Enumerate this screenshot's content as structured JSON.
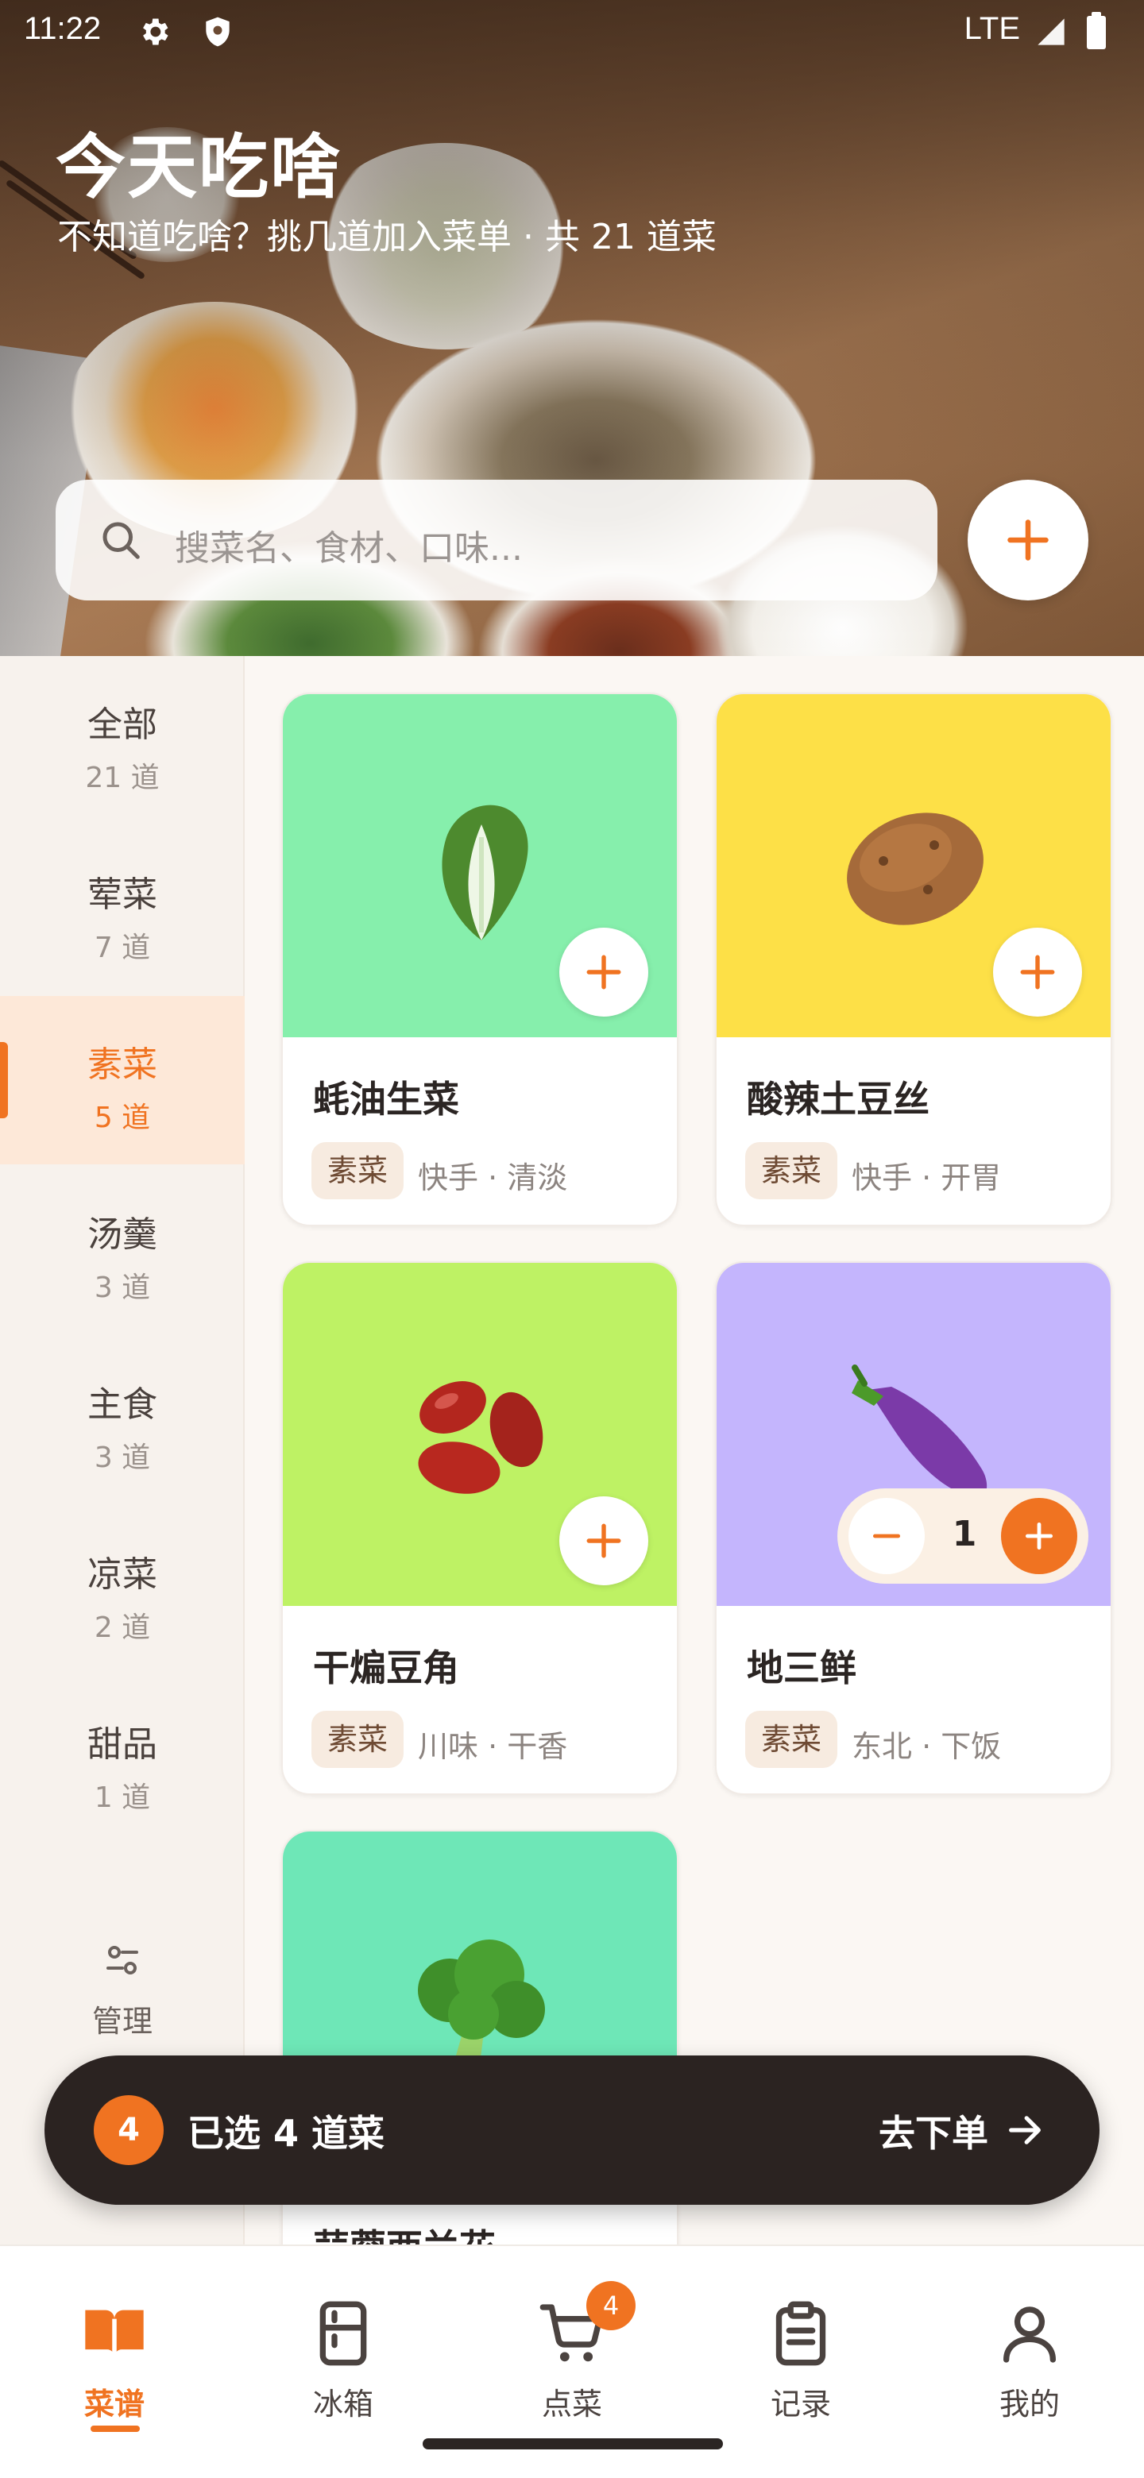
{
  "status": {
    "time": "11:22",
    "network": "LTE",
    "icons": [
      "gear-icon",
      "shield-icon",
      "signal-icon",
      "battery-icon"
    ]
  },
  "header": {
    "title": "今天吃啥",
    "subtitle": "不知道吃啥？挑几道加入菜单 · 共 21 道菜"
  },
  "search": {
    "placeholder": "搜菜名、食材、口味..."
  },
  "sidebar": {
    "categories": [
      {
        "name": "全部",
        "count": "21 道"
      },
      {
        "name": "荤菜",
        "count": "7 道"
      },
      {
        "name": "素菜",
        "count": "5 道",
        "active": true
      },
      {
        "name": "汤羹",
        "count": "3 道"
      },
      {
        "name": "主食",
        "count": "3 道"
      },
      {
        "name": "凉菜",
        "count": "2 道"
      },
      {
        "name": "甜品",
        "count": "1 道"
      }
    ],
    "manage": "管理"
  },
  "dishes": [
    {
      "name": "蚝油生菜",
      "tag": "素菜",
      "meta": "快手 · 清淡",
      "bg": "#86efac",
      "icon": "lettuce-icon"
    },
    {
      "name": "酸辣土豆丝",
      "tag": "素菜",
      "meta": "快手 · 开胃",
      "bg": "#fde047",
      "icon": "potato-icon"
    },
    {
      "name": "干煸豆角",
      "tag": "素菜",
      "meta": "川味 · 干香",
      "bg": "#bef264",
      "icon": "beans-icon"
    },
    {
      "name": "地三鲜",
      "tag": "素菜",
      "meta": "东北 · 下饭",
      "bg": "#c4b5fd",
      "icon": "eggplant-icon",
      "qty": "1"
    },
    {
      "name": "蒜蓉西兰花",
      "bg": "#6ee7b7",
      "icon": "broccoli-icon"
    }
  ],
  "cart": {
    "count": "4",
    "selected": "已选 4 道菜",
    "action": "去下单"
  },
  "tabs": [
    {
      "label": "菜谱",
      "active": true,
      "icon": "book-icon"
    },
    {
      "label": "冰箱",
      "icon": "fridge-icon"
    },
    {
      "label": "点菜",
      "icon": "cart-icon",
      "badge": "4"
    },
    {
      "label": "记录",
      "icon": "clipboard-icon"
    },
    {
      "label": "我的",
      "icon": "user-icon"
    }
  ],
  "colors": {
    "accent": "#f07321",
    "dark": "#2b2321"
  }
}
